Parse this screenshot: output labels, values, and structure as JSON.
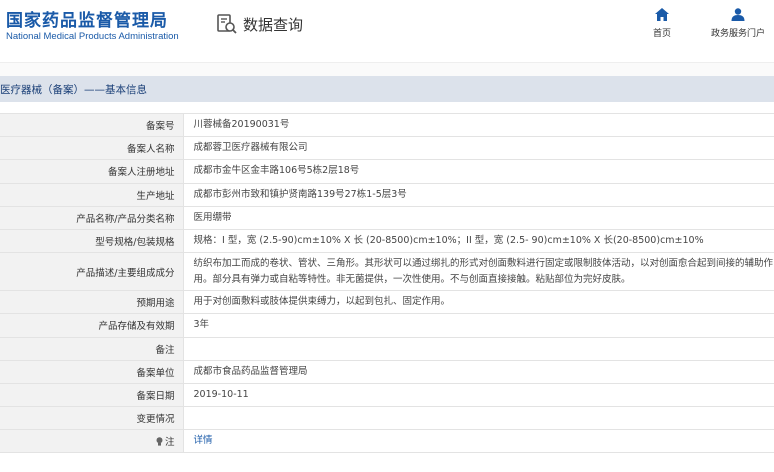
{
  "header": {
    "brand_cn": "国家药品监督管理局",
    "brand_en": "National Medical Products Administration",
    "query_title": "数据查询",
    "nav": {
      "home_label": "首页",
      "portal_label": "政务服务门户"
    }
  },
  "section": {
    "title": "医疗器械（备案）——基本信息"
  },
  "rows": [
    {
      "label": "备案号",
      "value": "川蓉械备20190031号"
    },
    {
      "label": "备案人名称",
      "value": "成都蓉卫医疗器械有限公司"
    },
    {
      "label": "备案人注册地址",
      "value": "成都市金牛区金丰路106号5栋2层18号"
    },
    {
      "label": "生产地址",
      "value": "成都市彭州市致和镇护贤南路139号27栋1-5层3号"
    },
    {
      "label": "产品名称/产品分类名称",
      "value": "医用绷带"
    },
    {
      "label": "型号规格/包装规格",
      "value": "规格：I 型，宽 (2.5-90)cm±10% X 长 (20-8500)cm±10%；II 型，宽 (2.5- 90)cm±10% X 长(20-8500)cm±10%"
    },
    {
      "label": "产品描述/主要组成成分",
      "value": "纺织布加工而成的卷状、管状、三角形。其形状可以通过绑扎的形式对创面敷料进行固定或限制肢体活动，以对创面愈合起到间接的辅助作用。部分具有弹力或自粘等特性。非无菌提供，一次性使用。不与创面直接接触。粘贴部位为完好皮肤。"
    },
    {
      "label": "预期用途",
      "value": "用于对创面敷料或肢体提供束缚力，以起到包扎、固定作用。"
    },
    {
      "label": "产品存储及有效期",
      "value": "3年"
    },
    {
      "label": "备注",
      "value": ""
    },
    {
      "label": "备案单位",
      "value": "成都市食品药品监督管理局"
    },
    {
      "label": "备案日期",
      "value": "2019-10-11"
    },
    {
      "label": "变更情况",
      "value": ""
    },
    {
      "label": "注",
      "value": "详情"
    }
  ],
  "colors": {
    "brand_blue": "#1a5aa8",
    "section_bg": "#dce2eb",
    "label_bg": "#f2f2f2"
  },
  "icons": {
    "query": "search-document-icon",
    "home": "home-icon",
    "portal": "user-icon",
    "note": "lightbulb-icon"
  }
}
